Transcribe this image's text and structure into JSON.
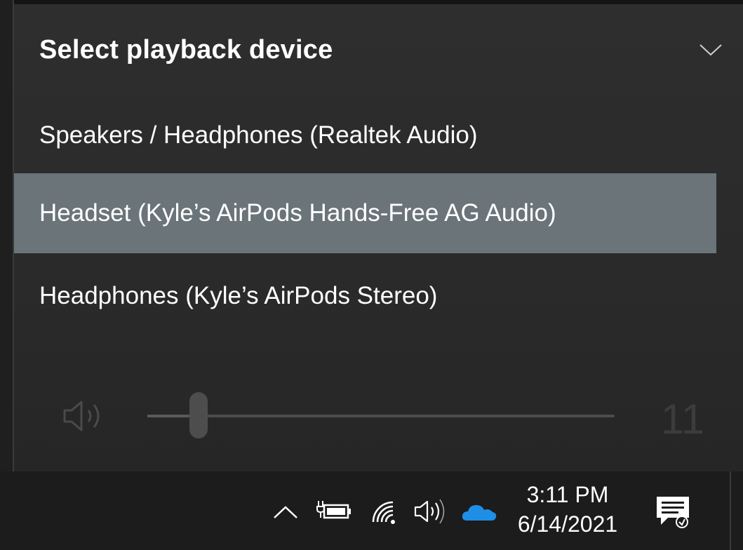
{
  "flyout": {
    "title": "Select playback device",
    "collapse_icon": "chevron-down-icon",
    "devices": [
      {
        "label": "Speakers / Headphones (Realtek Audio)",
        "selected": false
      },
      {
        "label": "Headset (Kyle’s AirPods Hands-Free AG Audio)",
        "selected": true
      },
      {
        "label": "Headphones (Kyle’s AirPods Stereo)",
        "selected": false
      }
    ],
    "volume": {
      "icon": "speaker-icon",
      "value": 11,
      "value_label": "11",
      "fraction": 0.11
    },
    "colors": {
      "selected_row": "#6a7479",
      "panel": "#2b2b2b"
    }
  },
  "taskbar": {
    "tray_icons": [
      "chevron-up-icon",
      "battery-plug-icon",
      "wifi-icon",
      "speaker-icon",
      "onedrive-cloud-icon",
      "notification-icon"
    ],
    "time": "3:11 PM",
    "date": "6/14/2021"
  }
}
